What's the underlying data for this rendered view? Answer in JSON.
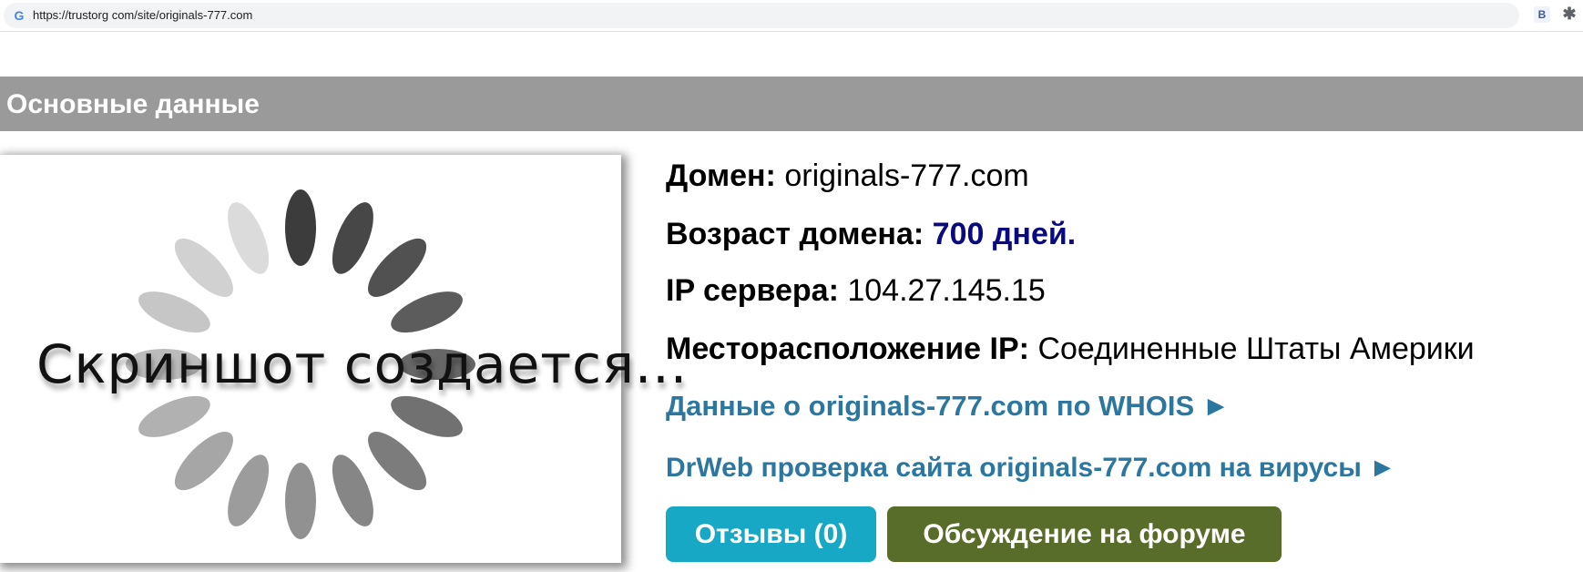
{
  "browser": {
    "url": "https://trustorg com/site/originals-777.com",
    "favicon": "G",
    "extensions": [
      {
        "name": "b-extension-icon",
        "glyph": "B"
      },
      {
        "name": "puzzle-icon",
        "glyph": "✱"
      }
    ]
  },
  "section": {
    "title": "Основные данные",
    "background": "#9a9a9a"
  },
  "screenshot": {
    "caption": "Скриншот создается...",
    "spinner_icon": "loading-spinner-icon"
  },
  "info": {
    "domain": {
      "label": "Домен:",
      "value": "originals-777.com"
    },
    "age": {
      "label": "Возраст домена:",
      "value": "700 дней."
    },
    "ip": {
      "label": "IP сервера:",
      "value": "104.27.145.15"
    },
    "location": {
      "label": "Месторасположение IP:",
      "value": "Соединенные Штаты Америки"
    }
  },
  "links": {
    "whois": "Данные о originals-777.com по WHOIS ►",
    "drweb": "DrWeb проверка сайта originals-777.com на вирусы ►"
  },
  "buttons": {
    "reviews": "Отзывы (0)",
    "forum": "Обсуждение на форуме"
  },
  "colors": {
    "link": "#2b77a0",
    "age_value": "#0a0a80",
    "reviews_button": "#17a8c6",
    "forum_button": "#586d2a"
  }
}
